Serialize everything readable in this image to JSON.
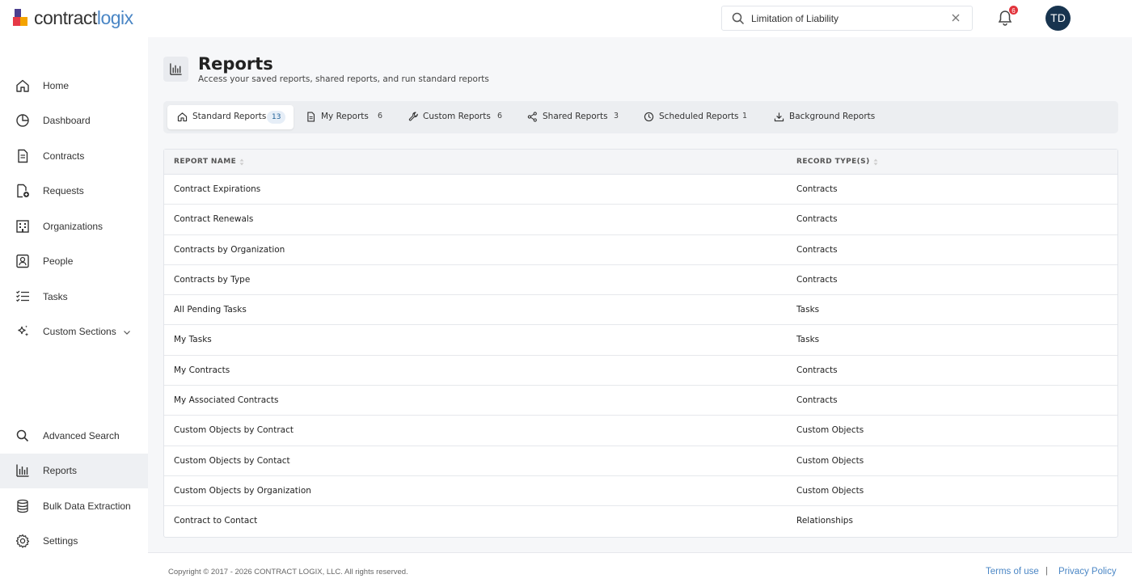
{
  "app": {
    "logo_part1": "contract",
    "logo_part2": "logix"
  },
  "header": {
    "search_value": "Limitation of Liability",
    "notification_count": "6",
    "avatar_initials": "TD"
  },
  "colors": {
    "accent": "#4a86c5",
    "avatar_bg": "#18344f",
    "badge": "#e2343c"
  },
  "sidebar": {
    "items": [
      {
        "label": "Home",
        "icon": "home-icon"
      },
      {
        "label": "Dashboard",
        "icon": "dashboard-icon"
      },
      {
        "label": "Contracts",
        "icon": "document-icon"
      },
      {
        "label": "Requests",
        "icon": "request-icon"
      },
      {
        "label": "Organizations",
        "icon": "building-icon"
      },
      {
        "label": "People",
        "icon": "person-icon"
      },
      {
        "label": "Tasks",
        "icon": "tasks-icon"
      },
      {
        "label": "Custom Sections",
        "icon": "sparkle-icon"
      }
    ],
    "bottom_items": [
      {
        "label": "Advanced Search",
        "icon": "search-icon"
      },
      {
        "label": "Reports",
        "icon": "reports-icon",
        "active": true
      },
      {
        "label": "Bulk Data Extraction",
        "icon": "database-icon"
      },
      {
        "label": "Settings",
        "icon": "gear-icon"
      }
    ]
  },
  "page": {
    "title": "Reports",
    "subtitle": "Access your saved reports, shared reports, and run standard reports"
  },
  "tabs": [
    {
      "label": "Standard Reports",
      "count": "13",
      "icon": "home-icon",
      "active": true
    },
    {
      "label": "My Reports",
      "count": "6",
      "icon": "document-icon"
    },
    {
      "label": "Custom Reports",
      "count": "6",
      "icon": "wrench-icon"
    },
    {
      "label": "Shared Reports",
      "count": "3",
      "icon": "share-icon"
    },
    {
      "label": "Scheduled Reports",
      "count": "1",
      "icon": "clock-icon"
    },
    {
      "label": "Background Reports",
      "count": "",
      "icon": "download-icon"
    }
  ],
  "table": {
    "columns": [
      "REPORT NAME",
      "RECORD TYPE(S)"
    ],
    "rows": [
      [
        "Contract Expirations",
        "Contracts"
      ],
      [
        "Contract Renewals",
        "Contracts"
      ],
      [
        "Contracts by Organization",
        "Contracts"
      ],
      [
        "Contracts by Type",
        "Contracts"
      ],
      [
        "All Pending Tasks",
        "Tasks"
      ],
      [
        "My Tasks",
        "Tasks"
      ],
      [
        "My Contracts",
        "Contracts"
      ],
      [
        "My Associated Contracts",
        "Contracts"
      ],
      [
        "Custom Objects by Contract",
        "Custom Objects"
      ],
      [
        "Custom Objects by Contact",
        "Custom Objects"
      ],
      [
        "Custom Objects by Organization",
        "Custom Objects"
      ],
      [
        "Contract to Contact",
        "Relationships"
      ]
    ]
  },
  "footer": {
    "copyright": "Copyright © 2017 - 2026 CONTRACT LOGIX, LLC. All rights reserved.",
    "terms": "Terms of use",
    "separator": "|",
    "privacy": "Privacy Policy"
  }
}
